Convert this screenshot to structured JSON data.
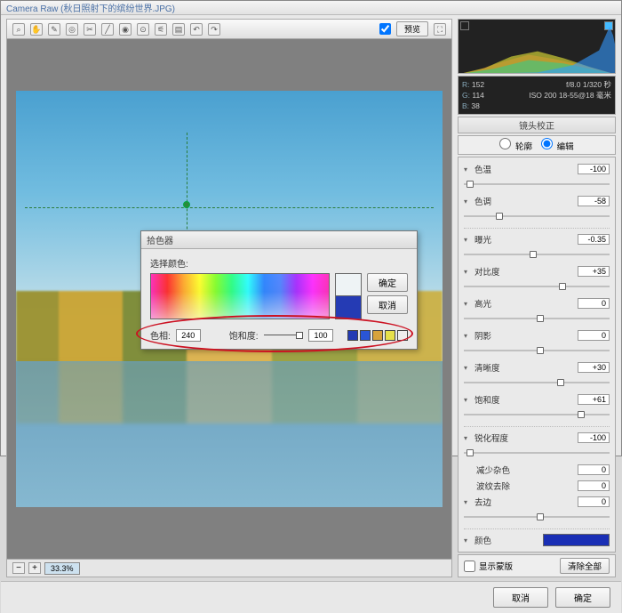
{
  "window": {
    "title": "Camera Raw (秋日照射下的缤纷世界.JPG)"
  },
  "toolbar": {
    "preview_label": "预览",
    "tools": [
      "zoom",
      "hand",
      "eyedropper",
      "sampler",
      "crop",
      "straighten",
      "spot",
      "redeye",
      "adjust",
      "gradient",
      "rotate-ccw",
      "rotate-cw"
    ]
  },
  "footer": {
    "zoom": "33.3%"
  },
  "info": {
    "r_label": "R:",
    "r": "152",
    "g_label": "G:",
    "g": "114",
    "b_label": "B:",
    "b": "38",
    "line1": "f/8.0   1/320 秒",
    "line2": "ISO 200   18-55@18 毫米"
  },
  "panel": {
    "title": "镜头校正",
    "radio_a": "轮廓",
    "radio_b": "编辑",
    "sliders": {
      "temp": {
        "label": "色温",
        "value": "-100"
      },
      "tint": {
        "label": "色调",
        "value": "-58"
      },
      "exposure": {
        "label": "曝光",
        "value": "-0.35"
      },
      "contrast": {
        "label": "对比度",
        "value": "+35"
      },
      "highlights": {
        "label": "高光",
        "value": "0"
      },
      "shadows": {
        "label": "阴影",
        "value": "0"
      },
      "clarity": {
        "label": "清晰度",
        "value": "+30"
      },
      "saturation": {
        "label": "饱和度",
        "value": "+61"
      },
      "sharpness": {
        "label": "锐化程度",
        "value": "-100"
      },
      "nr": {
        "label": "减少杂色",
        "value": "0"
      },
      "moire": {
        "label": "波纹去除",
        "value": "0"
      },
      "defringe": {
        "label": "去边",
        "value": "0"
      },
      "color": {
        "label": "颜色"
      }
    },
    "checkbox_label": "显示蒙版",
    "reset_label": "清除全部"
  },
  "buttons": {
    "cancel": "取消",
    "ok": "确定"
  },
  "picker": {
    "title": "拾色器",
    "select_label": "选择颜色:",
    "ok": "确定",
    "cancel": "取消",
    "hue_label": "色相:",
    "hue_value": "240",
    "sat_label": "饱和度:",
    "sat_value": "100",
    "swatches": [
      "#243bb4",
      "#2a55d6",
      "#d8a33b",
      "#e6e04b",
      "#eeeeee"
    ]
  }
}
